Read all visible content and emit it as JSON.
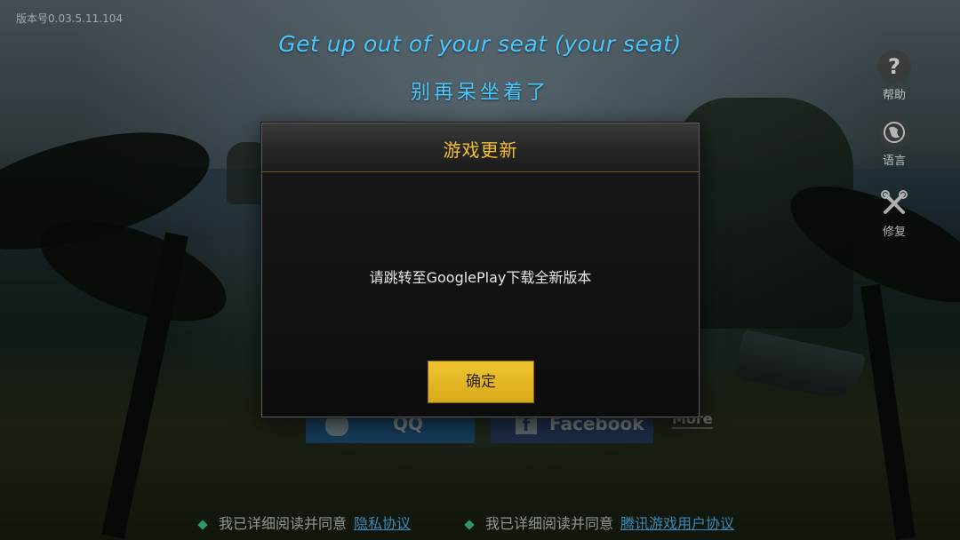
{
  "version_text": "版本号0.03.5.11.104",
  "lyrics": {
    "english": "Get up out of your seat (your seat)",
    "chinese": "别再呆坐着了"
  },
  "side_menu": {
    "help_label": "帮助",
    "help_glyph": "?",
    "language_label": "语言",
    "repair_label": "修复"
  },
  "login": {
    "qq_label": "QQ",
    "facebook_label": "Facebook",
    "facebook_glyph": "f",
    "more_label": "More"
  },
  "agreements": [
    {
      "text": "我已详细阅读并同意",
      "link": "隐私协议"
    },
    {
      "text": "我已详细阅读并同意",
      "link": "腾讯游戏用户协议"
    }
  ],
  "dialog": {
    "title": "游戏更新",
    "message": "请跳转至GooglePlay下载全新版本",
    "confirm_label": "确定"
  },
  "colors": {
    "lyric": "#48c8ff",
    "dialog_title": "#f2c22e",
    "confirm_button": "#f0c431",
    "agree_link": "#49b8ff",
    "agree_diamond": "#3bd28a"
  }
}
